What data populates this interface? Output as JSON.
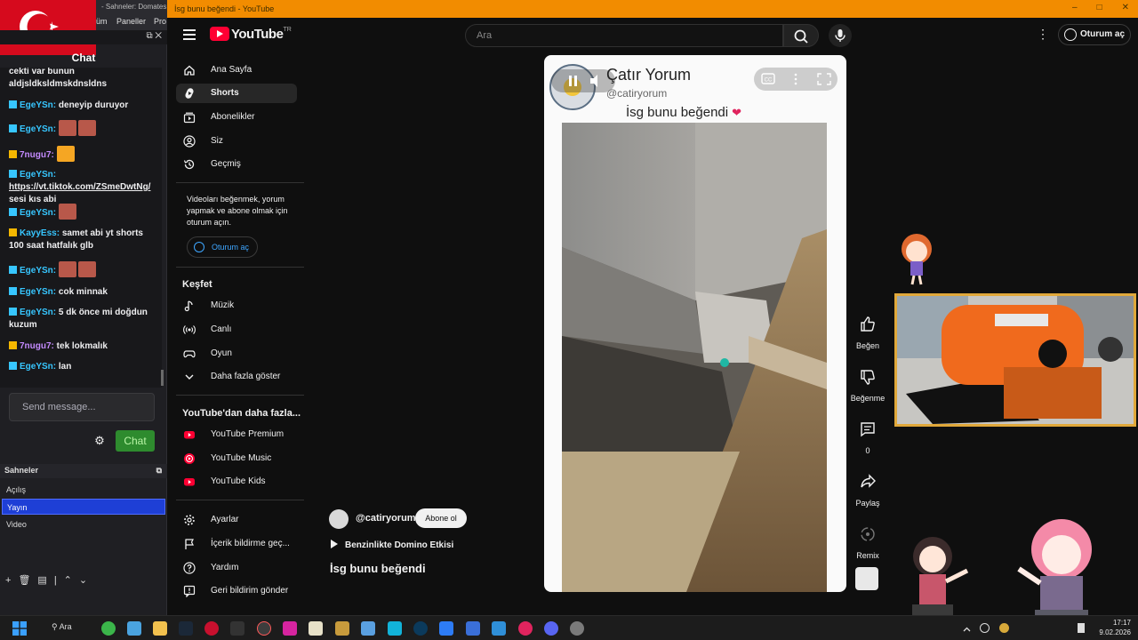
{
  "obs": {
    "window_title": "- Sahneler: Domates",
    "menus": [
      "üm",
      "Paneller",
      "Pro"
    ],
    "chat_title": "Chat",
    "messages": [
      {
        "user": "",
        "text": "cekti var bunun"
      },
      {
        "user": "",
        "text": "aldjsldksldmskdnsldns"
      },
      {
        "user": "EgeYSn:",
        "text": "deneyip duruyor"
      },
      {
        "user": "EgeYSn:",
        "text": ""
      },
      {
        "user": "7nugu7:",
        "text": ""
      },
      {
        "user": "EgeYSn:",
        "link": "https://vt.tiktok.com/ZSmeDwtNg/",
        "text": "sesi kıs abi"
      },
      {
        "user": "EgeYSn:",
        "text": ""
      },
      {
        "user": "KayyEss:",
        "text": "samet abi yt shorts 100 saat hatfalık glb"
      },
      {
        "user": "EgeYSn:",
        "text": ""
      },
      {
        "user": "EgeYSn:",
        "text": "cok minnak"
      },
      {
        "user": "EgeYSn:",
        "text": "5 dk önce mi doğdun kuzum"
      },
      {
        "user": "7nugu7:",
        "text": "tek lokmalık"
      },
      {
        "user": "EgeYSn:",
        "text": "lan"
      }
    ],
    "input_placeholder": "Send message...",
    "send_label": "Chat",
    "scenes_title": "Sahneler",
    "scenes": [
      "Açılış",
      "Yayın",
      "Video"
    ],
    "selected_scene": "Yayın",
    "colors": {
      "accent": "#1e3fd6",
      "send": "#2e8b2e",
      "flag": "#d60a1d"
    }
  },
  "browser": {
    "title": "İsg bunu beğendi - YouTube",
    "controls": [
      "–",
      "□",
      "✕"
    ],
    "accent": "#f28c00"
  },
  "youtube": {
    "logo": "YouTube",
    "logo_sup": "TR",
    "search_placeholder": "Ara",
    "signin": "Oturum aç",
    "nav_main": [
      {
        "label": "Ana Sayfa",
        "icon": "home-icon"
      },
      {
        "label": "Shorts",
        "icon": "shorts-icon",
        "selected": true
      },
      {
        "label": "Abonelikler",
        "icon": "subscriptions-icon"
      },
      {
        "label": "Siz",
        "icon": "account-icon"
      },
      {
        "label": "Geçmiş",
        "icon": "history-icon"
      }
    ],
    "promo": "Videoları beğenmek, yorum yapmak ve abone olmak için oturum açın.",
    "promo_signin": "Oturum aç",
    "explore_title": "Keşfet",
    "nav_explore": [
      {
        "label": "Müzik",
        "icon": "music-icon"
      },
      {
        "label": "Canlı",
        "icon": "live-icon"
      },
      {
        "label": "Oyun",
        "icon": "gaming-icon"
      },
      {
        "label": "Daha fazla göster",
        "icon": "chevron-down-icon"
      }
    ],
    "more_title": "YouTube'dan daha fazla...",
    "nav_more": [
      {
        "label": "YouTube Premium",
        "icon": "youtube-premium-icon"
      },
      {
        "label": "YouTube Music",
        "icon": "youtube-music-icon"
      },
      {
        "label": "YouTube Kids",
        "icon": "youtube-kids-icon"
      }
    ],
    "nav_bottom": [
      {
        "label": "Ayarlar",
        "icon": "settings-icon"
      },
      {
        "label": "İçerik bildirme geç...",
        "icon": "flag-icon"
      },
      {
        "label": "Yardım",
        "icon": "help-icon"
      },
      {
        "label": "Geri bildirim gönder",
        "icon": "feedback-icon"
      }
    ]
  },
  "short": {
    "channel_name": "Çatır Yorum",
    "channel_handle": "@catiryorum",
    "liked_text": "İsg bunu beğendi",
    "like_label": "Beğen",
    "dislike_label": "Beğenme",
    "comments_count": "0",
    "share_label": "Paylaş",
    "remix_label": "Remix",
    "meta_handle": "@catiryorum",
    "subscribe_label": "Abone ol",
    "music_title": "Benzinlikte Domino Etkisi",
    "video_title": "İsg bunu beğendi"
  },
  "taskbar": {
    "search_label": "Ara",
    "time": "17:17",
    "date": "9.02.2026"
  }
}
